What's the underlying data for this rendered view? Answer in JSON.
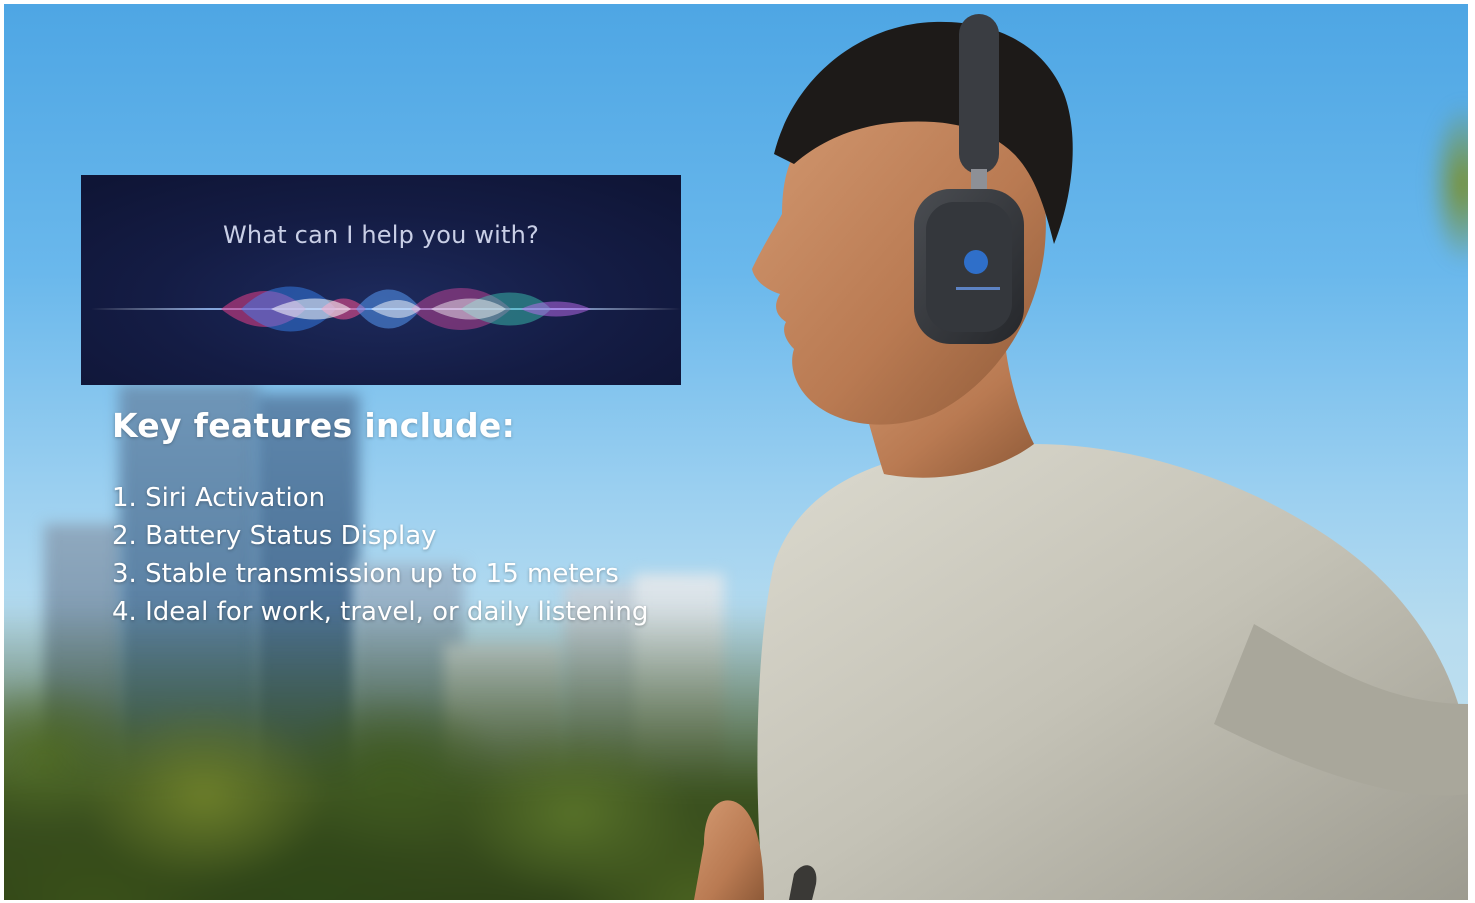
{
  "siri_card": {
    "prompt": "What can I help you with?"
  },
  "features": {
    "title": "Key features include:",
    "items": [
      "1. Siri Activation",
      "2. Battery Status Display",
      "3. Stable transmission up to 15 meters",
      "4. Ideal for work, travel, or daily listening"
    ]
  },
  "colors": {
    "sky": "#5aaee8",
    "card_background": "#141c44",
    "headphones": "#3a3d42",
    "shirt": "#c9c7bc"
  }
}
